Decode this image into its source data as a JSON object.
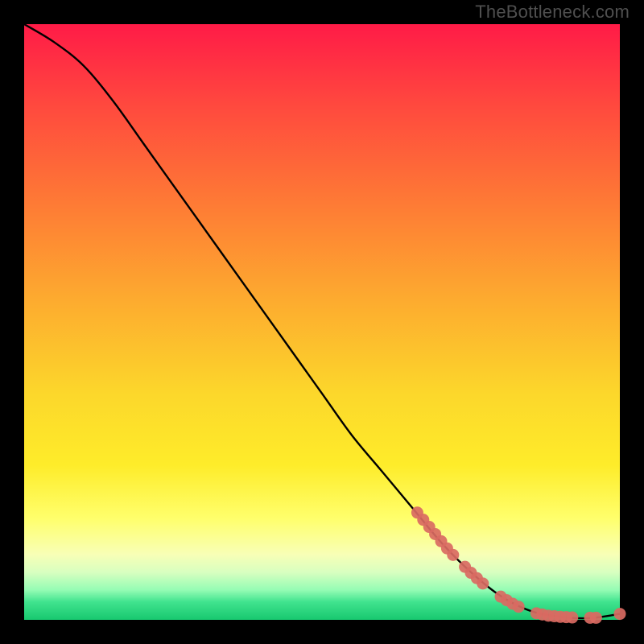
{
  "attribution": "TheBottleneck.com",
  "chart_data": {
    "type": "line",
    "title": "",
    "xlabel": "",
    "ylabel": "",
    "xlim": [
      0,
      100
    ],
    "ylim": [
      0,
      100
    ],
    "series": [
      {
        "name": "curve",
        "x": [
          0,
          5,
          10,
          15,
          20,
          25,
          30,
          35,
          40,
          45,
          50,
          55,
          60,
          65,
          70,
          75,
          80,
          85,
          90,
          95,
          100
        ],
        "y": [
          100,
          97,
          93,
          87,
          80,
          73,
          66,
          59,
          52,
          45,
          38,
          31,
          25,
          19,
          13,
          8,
          4,
          1.5,
          0.5,
          0.3,
          1
        ]
      }
    ],
    "markers": [
      {
        "x": 66,
        "y": 18.0
      },
      {
        "x": 67,
        "y": 16.8
      },
      {
        "x": 68,
        "y": 15.6
      },
      {
        "x": 69,
        "y": 14.4
      },
      {
        "x": 70,
        "y": 13.2
      },
      {
        "x": 71,
        "y": 12.0
      },
      {
        "x": 72,
        "y": 10.9
      },
      {
        "x": 74,
        "y": 8.9
      },
      {
        "x": 75,
        "y": 7.9
      },
      {
        "x": 76,
        "y": 7.0
      },
      {
        "x": 77,
        "y": 6.1
      },
      {
        "x": 80,
        "y": 3.9
      },
      {
        "x": 81,
        "y": 3.3
      },
      {
        "x": 82,
        "y": 2.7
      },
      {
        "x": 83,
        "y": 2.2
      },
      {
        "x": 86,
        "y": 1.1
      },
      {
        "x": 87,
        "y": 0.9
      },
      {
        "x": 88,
        "y": 0.7
      },
      {
        "x": 89,
        "y": 0.6
      },
      {
        "x": 90,
        "y": 0.5
      },
      {
        "x": 91,
        "y": 0.45
      },
      {
        "x": 92,
        "y": 0.4
      },
      {
        "x": 95,
        "y": 0.35
      },
      {
        "x": 96,
        "y": 0.35
      },
      {
        "x": 100,
        "y": 1.0
      }
    ]
  }
}
